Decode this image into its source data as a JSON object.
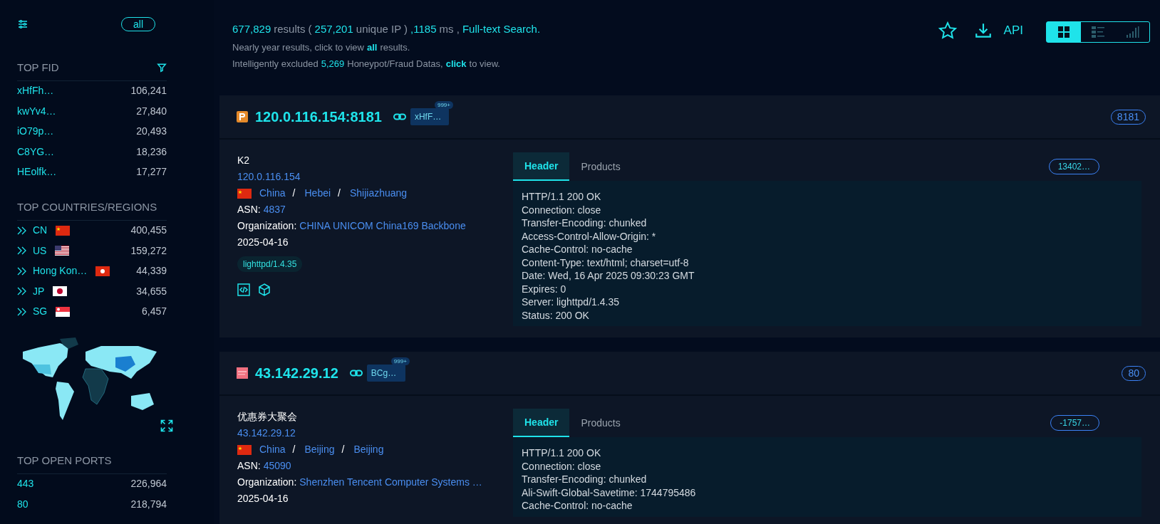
{
  "sidebar": {
    "filter_button": "all",
    "top_fid": {
      "title": "TOP FID",
      "items": [
        {
          "label": "xHfFh…",
          "count": "106,241"
        },
        {
          "label": "kwYv4…",
          "count": "27,840"
        },
        {
          "label": "iO79p…",
          "count": "20,493"
        },
        {
          "label": "C8YG…",
          "count": "18,236"
        },
        {
          "label": "HEolfk…",
          "count": "17,277"
        }
      ]
    },
    "countries": {
      "title": "TOP COUNTRIES/REGIONS",
      "items": [
        {
          "label": "CN",
          "kind": "cn",
          "count": "400,455"
        },
        {
          "label": "US",
          "kind": "us",
          "count": "159,272"
        },
        {
          "label": "Hong Kon…",
          "kind": "hk",
          "count": "44,339"
        },
        {
          "label": "JP",
          "kind": "jp",
          "count": "34,655"
        },
        {
          "label": "SG",
          "kind": "sg",
          "count": "6,457"
        }
      ]
    },
    "ports": {
      "title": "TOP OPEN PORTS",
      "items": [
        {
          "label": "443",
          "count": "226,964"
        },
        {
          "label": "80",
          "count": "218,794"
        }
      ]
    }
  },
  "summary": [
    [
      {
        "kind": "value",
        "text": "677,829"
      },
      {
        "kind": "text",
        "text": "results ("
      },
      {
        "kind": "value",
        "text": "257,201"
      },
      {
        "kind": "text",
        "text": "unique IP )"
      },
      {
        "kind": "value",
        "text": ",1185"
      },
      {
        "kind": "text",
        "text": "ms ,"
      },
      {
        "kind": "value",
        "text": "Full-text Search."
      }
    ],
    [
      {
        "kind": "text",
        "text": "Nearly year results, click to view"
      },
      {
        "kind": "link",
        "text": "all"
      },
      {
        "kind": "text",
        "text": "results."
      }
    ],
    [
      {
        "kind": "text",
        "text": "Intelligently excluded"
      },
      {
        "kind": "value",
        "text": "5,269"
      },
      {
        "kind": "text",
        "text": "Honeypot/Fraud Datas,"
      },
      {
        "kind": "link",
        "text": "click"
      },
      {
        "kind": "text",
        "text": "to view."
      }
    ]
  ],
  "toolbar": {
    "api_label": "API",
    "views": [
      {
        "kind": "grid",
        "selected": true
      },
      {
        "kind": "list",
        "selected": false
      },
      {
        "kind": "stats",
        "selected": false
      }
    ]
  },
  "results": [
    {
      "logo": {
        "kind": "p"
      },
      "address": "120.0.116.154:8181",
      "fid": "xHfF…",
      "fid_badge": "999+",
      "port": "8181",
      "title": "K2",
      "ip": "120.0.116.154",
      "country_flag": {
        "kind": "cn"
      },
      "location": [
        {
          "name": "China"
        },
        {
          "separator": "/",
          "name": "Hebei"
        },
        {
          "separator": "/",
          "name": "Shijiazhuang"
        }
      ],
      "asn_label": "ASN:",
      "asn": "4837",
      "org_label": "Organization:",
      "org": "CHINA UNICOM China169 Backbone",
      "date": "2025-04-16",
      "tags": [
        "lighttpd/1.4.35"
      ],
      "actions": [
        {
          "kind": "code"
        },
        {
          "kind": "cube"
        }
      ],
      "tabs": [
        {
          "label": "Header",
          "selected": true
        },
        {
          "label": "Products",
          "selected": false
        }
      ],
      "hash": "13402…",
      "header_lines": [
        "HTTP/1.1 200 OK",
        "Connection: close",
        "Transfer-Encoding: chunked",
        "Access-Control-Allow-Origin: *",
        "Cache-Control: no-cache",
        "Content-Type: text/html; charset=utf-8",
        "Date: Wed, 16 Apr 2025 09:30:23 GMT",
        "Expires: 0",
        "Server: lighttpd/1.4.35",
        "Status: 200 OK"
      ]
    },
    {
      "logo": {
        "kind": "block"
      },
      "address": "43.142.29.12",
      "fid": "BCg…",
      "fid_badge": "999+",
      "port": "80",
      "title": "优惠券大聚会",
      "ip": "43.142.29.12",
      "country_flag": {
        "kind": "cn"
      },
      "location": [
        {
          "name": "China"
        },
        {
          "separator": "/",
          "name": "Beijing"
        },
        {
          "separator": "/",
          "name": "Beijing"
        }
      ],
      "asn_label": "ASN:",
      "asn": "45090",
      "org_label": "Organization:",
      "org": "Shenzhen Tencent Computer Systems …",
      "date": "2025-04-16",
      "tabs": [
        {
          "label": "Header",
          "selected": true
        },
        {
          "label": "Products",
          "selected": false
        }
      ],
      "hash": "-1757…",
      "header_lines": [
        "HTTP/1.1 200 OK",
        "Connection: close",
        "Transfer-Encoding: chunked",
        "Ali-Swift-Global-Savetime: 1744795486",
        "Cache-Control: no-cache"
      ]
    }
  ]
}
